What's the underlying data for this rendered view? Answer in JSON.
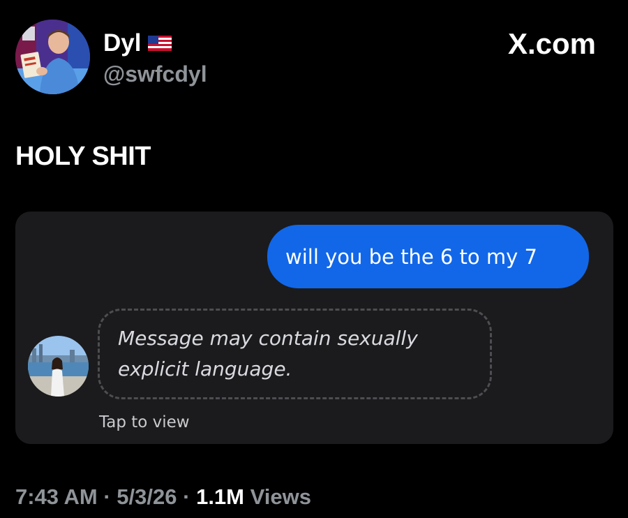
{
  "author": {
    "display_name": "Dyl",
    "handle": "@swfcdyl",
    "flag_icon": "us-flag-icon"
  },
  "brand": {
    "label": "X.com"
  },
  "tweet": {
    "text": "HOLY SHIT"
  },
  "media": {
    "sent_message": "will you be the 6 to my 7",
    "warning_message": "Message may contain sexually explicit language.",
    "tap_to_view": "Tap to view"
  },
  "footer": {
    "time": "7:43 AM",
    "separator": "·",
    "date": "5/3/26",
    "views_count": "1.1M",
    "views_label": "Views"
  },
  "colors": {
    "background": "#000000",
    "card": "#1b1b1d",
    "sent_bubble": "#1167e8",
    "muted_text": "#8f9499"
  }
}
